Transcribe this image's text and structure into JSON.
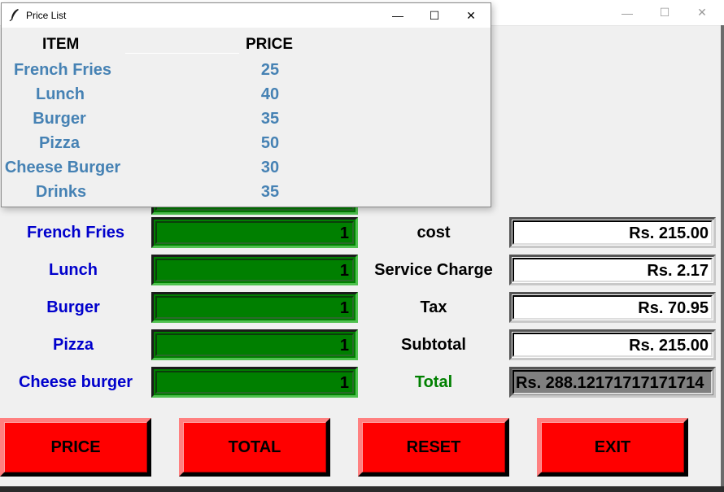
{
  "main_window": {
    "controls": {
      "minimize": "—",
      "maximize": "☐",
      "close": "✕"
    }
  },
  "items": [
    {
      "name": "French Fries",
      "qty": "1"
    },
    {
      "name": "Lunch",
      "qty": "1"
    },
    {
      "name": "Burger",
      "qty": "1"
    },
    {
      "name": "Pizza",
      "qty": "1"
    },
    {
      "name": "Cheese burger",
      "qty": "1"
    }
  ],
  "costs": [
    {
      "label": "cost",
      "value": "Rs. 215.00"
    },
    {
      "label": "Service Charge",
      "value": "Rs. 2.17"
    },
    {
      "label": "Tax",
      "value": "Rs. 70.95"
    },
    {
      "label": "Subtotal",
      "value": "Rs. 215.00"
    },
    {
      "label": "Total",
      "value": "Rs. 288.12171717171714"
    }
  ],
  "buttons": {
    "price": "PRICE",
    "total": "TOTAL",
    "reset": "RESET",
    "exit": "EXIT"
  },
  "price_list": {
    "title": "Price List",
    "controls": {
      "minimize": "—",
      "maximize": "☐",
      "close": "✕"
    },
    "header_item": "ITEM",
    "header_price": "PRICE",
    "rows": [
      {
        "item": "French Fries",
        "price": "25"
      },
      {
        "item": "Lunch",
        "price": "40"
      },
      {
        "item": "Burger",
        "price": "35"
      },
      {
        "item": "Pizza",
        "price": "50"
      },
      {
        "item": "Cheese Burger",
        "price": "30"
      },
      {
        "item": "Drinks",
        "price": "35"
      }
    ]
  },
  "colors": {
    "button": "#ff0000",
    "qty_field": "#007f00",
    "item_label": "#0000cc",
    "total_label": "#008000",
    "price_list_text": "#4682b4"
  }
}
